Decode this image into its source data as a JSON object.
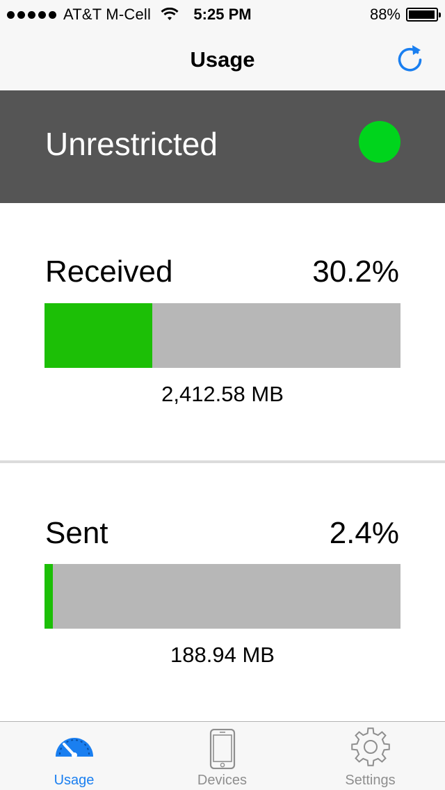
{
  "status_bar": {
    "carrier": "AT&T M-Cell",
    "time": "5:25 PM",
    "battery_percent": "88%",
    "signal_bars": 5,
    "battery_level": 0.88
  },
  "nav": {
    "title": "Usage",
    "refresh_icon": "refresh-icon"
  },
  "status": {
    "label": "Unrestricted",
    "indicator_color": "#00d41c"
  },
  "received": {
    "label": "Received",
    "percent_text": "30.2%",
    "percent_value": 30.2,
    "amount": "2,412.58 MB"
  },
  "sent": {
    "label": "Sent",
    "percent_text": "2.4%",
    "percent_value": 2.4,
    "amount": "188.94 MB"
  },
  "colors": {
    "accent": "#1a7ff0",
    "bar_fill": "#1cbf06",
    "bar_track": "#b7b7b7",
    "status_band": "#555555"
  },
  "tabs": [
    {
      "label": "Usage",
      "icon": "speedometer-icon",
      "active": true
    },
    {
      "label": "Devices",
      "icon": "phone-icon",
      "active": false
    },
    {
      "label": "Settings",
      "icon": "gear-icon",
      "active": false
    }
  ]
}
